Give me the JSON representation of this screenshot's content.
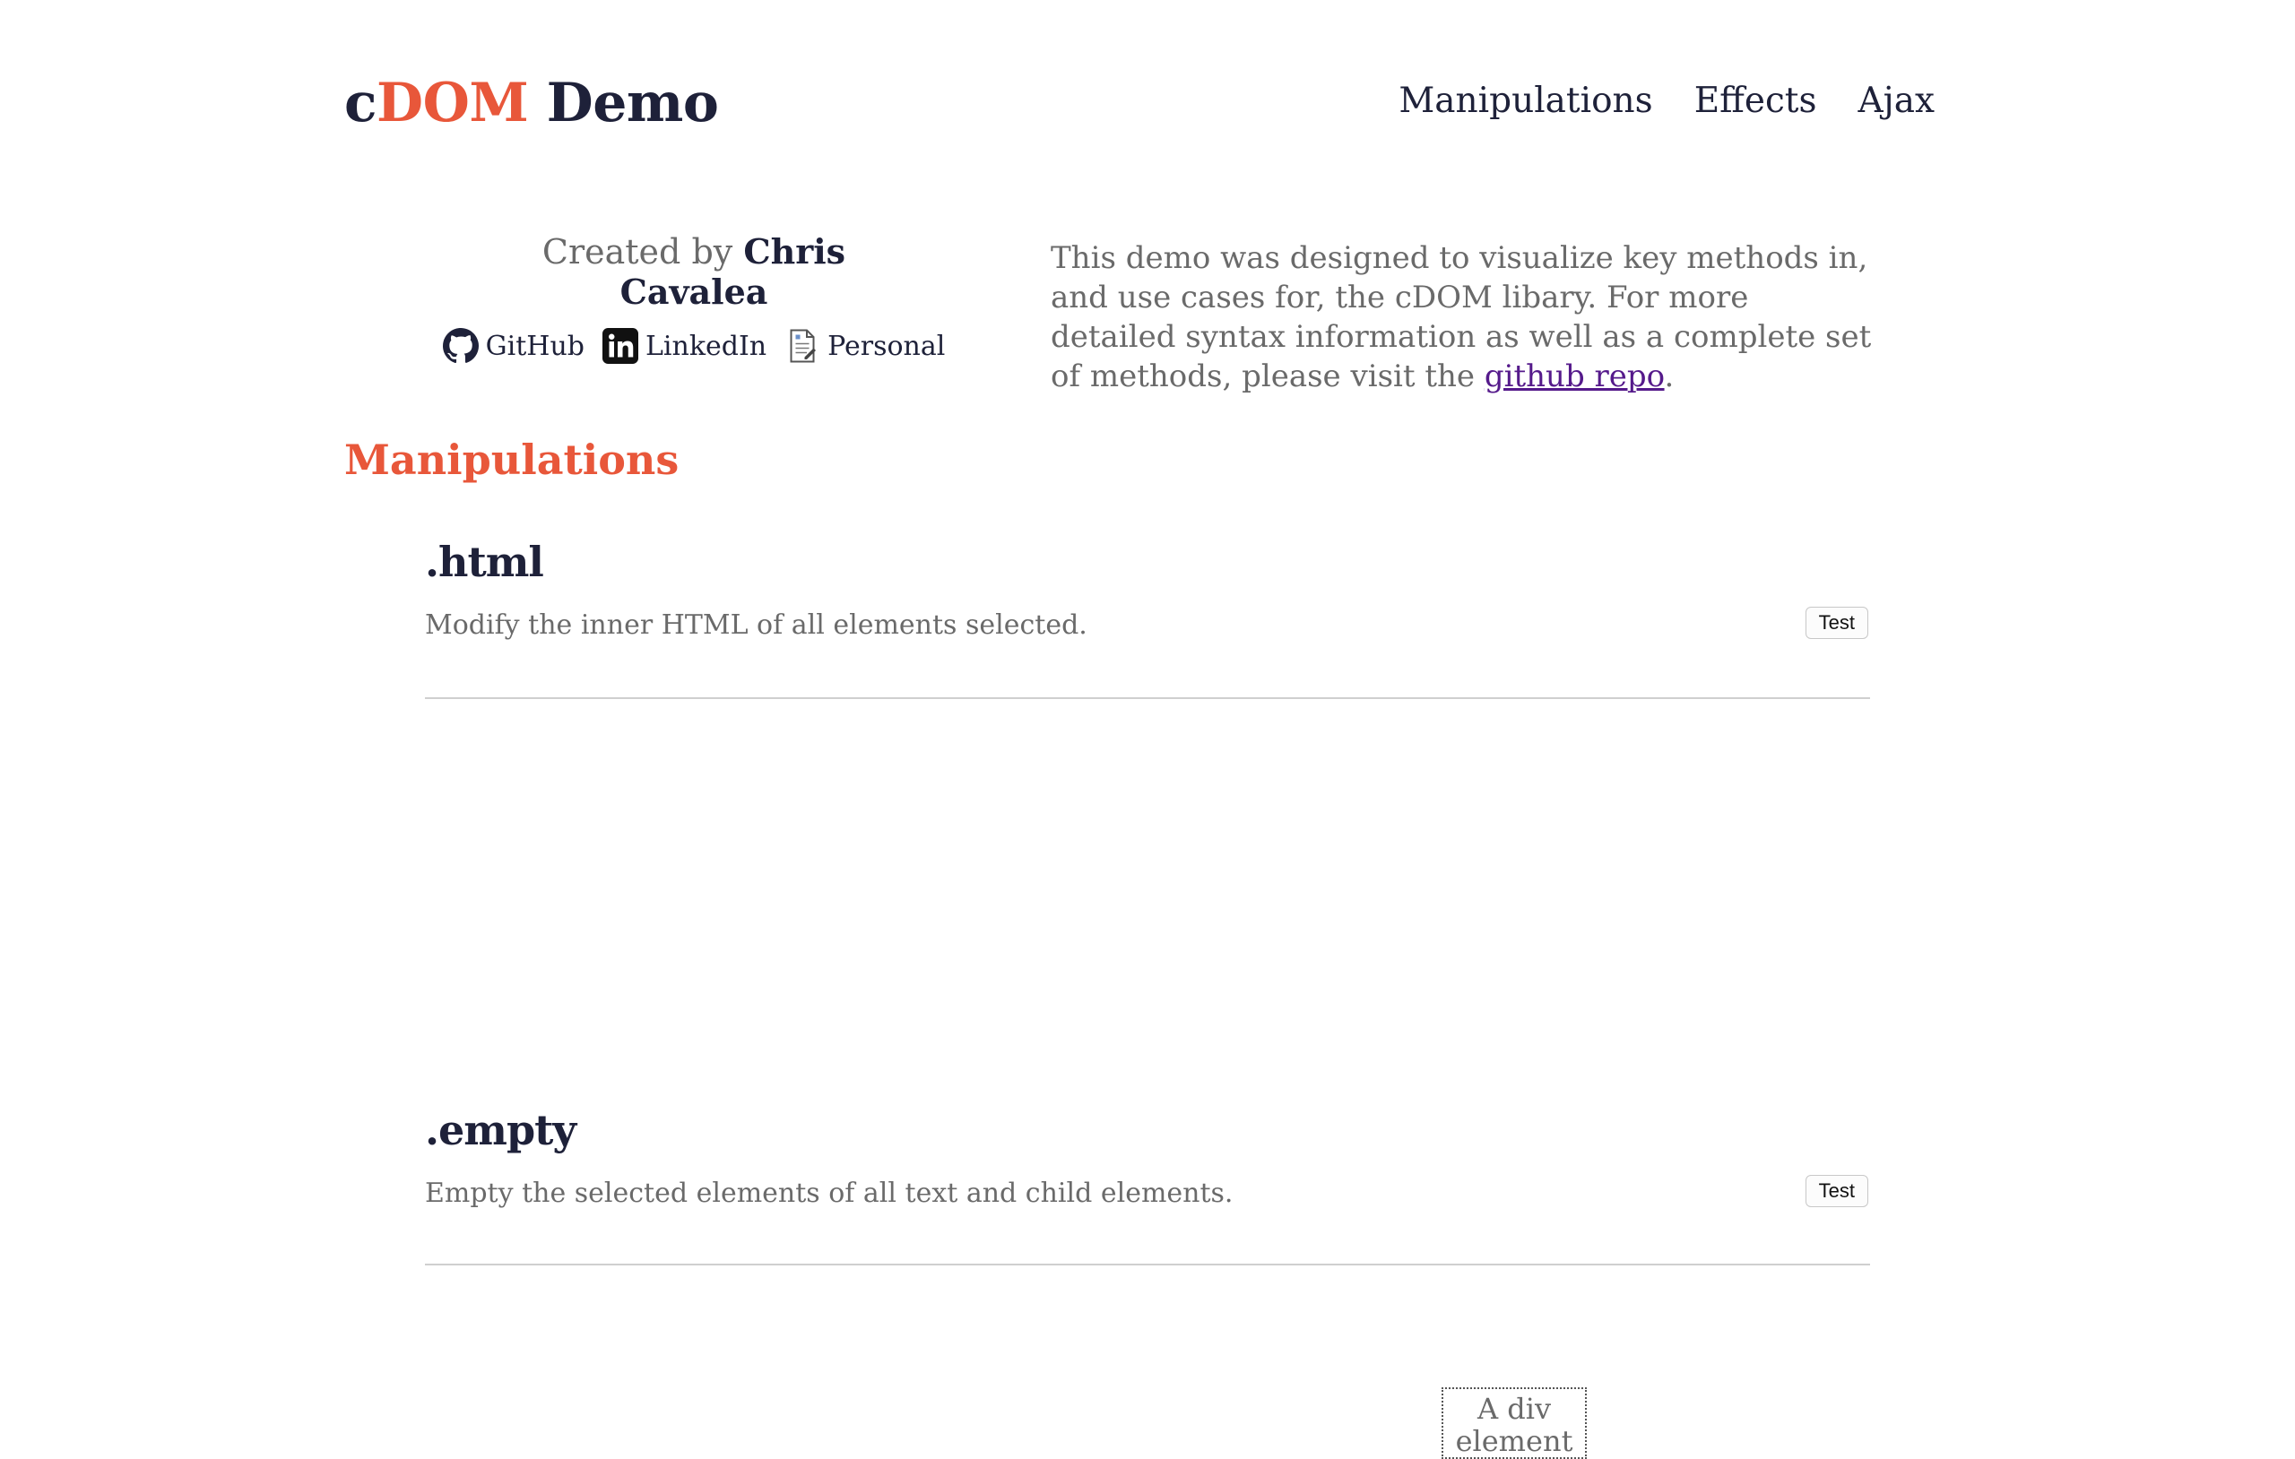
{
  "header": {
    "brand_prefix": "c",
    "brand_accent": "DOM",
    "brand_suffix": "Demo",
    "nav": [
      "Manipulations",
      "Effects",
      "Ajax"
    ]
  },
  "intro": {
    "created_by": "Created by",
    "author": "Chris Cavalea",
    "links": [
      {
        "label": "GitHub",
        "icon": "github-icon"
      },
      {
        "label": "LinkedIn",
        "icon": "linkedin-icon"
      },
      {
        "label": "Personal",
        "icon": "document-icon"
      }
    ],
    "blurb_before": "This demo was designed to visualize key methods in, and use cases for, the cDOM libary. For more detailed syntax information as well as a complete set of methods, please visit the ",
    "blurb_link": "github repo",
    "blurb_after": "."
  },
  "section": {
    "title": "Manipulations"
  },
  "methods": [
    {
      "name": ".html",
      "description": "Modify the inner HTML of all elements selected.",
      "button": "Test"
    },
    {
      "name": ".empty",
      "description": "Empty the selected elements of all text and child elements.",
      "button": "Test"
    }
  ],
  "demo": {
    "box_text": "A div element"
  },
  "colors": {
    "accent": "#e8573a",
    "heading": "#1e2139",
    "body_text": "#6a6a6a",
    "link_visited": "#551a8b"
  }
}
